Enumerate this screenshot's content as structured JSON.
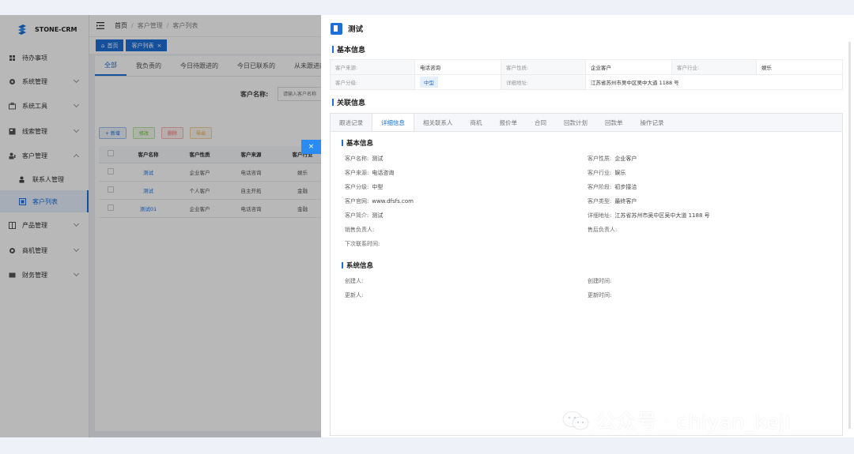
{
  "sidebar": {
    "logo": "STONE-CRM",
    "items": [
      {
        "label": "待办事项",
        "icon": "home-icon"
      },
      {
        "label": "系统管理",
        "icon": "gear-icon"
      },
      {
        "label": "系统工具",
        "icon": "tool-icon"
      },
      {
        "label": "线索管理",
        "icon": "clue-icon"
      },
      {
        "label": "客户管理",
        "icon": "user-icon"
      },
      {
        "label": "联系人管理",
        "icon": "contact-icon"
      },
      {
        "label": "客户列表",
        "icon": "list-icon"
      },
      {
        "label": "产品管理",
        "icon": "product-icon"
      },
      {
        "label": "商机管理",
        "icon": "opportunity-icon"
      },
      {
        "label": "财务管理",
        "icon": "finance-icon"
      }
    ]
  },
  "breadcrumb": [
    "首页",
    "客户管理",
    "客户列表"
  ],
  "tags": [
    {
      "label": "首页",
      "icon": "home-icon"
    },
    {
      "label": "客户列表"
    }
  ],
  "list_tabs": [
    "全部",
    "我负责的",
    "今日待跟进的",
    "今日已联系的",
    "从未跟进的"
  ],
  "search": {
    "label": "客户名称:",
    "placeholder": "请输入客户名称"
  },
  "toolbar": {
    "add": "+ 新增",
    "edit": "修改",
    "delete": "删除",
    "export": "导出"
  },
  "table": {
    "headers": [
      "客户名称",
      "客户性质",
      "客户来源",
      "客户行业"
    ],
    "rows": [
      [
        "测试",
        "企业客户",
        "电话咨询",
        "娱乐"
      ],
      [
        "测试",
        "个人客户",
        "自主开拓",
        "金融"
      ],
      [
        "测试01",
        "企业客户",
        "电话咨询",
        "金融"
      ]
    ]
  },
  "close_symbol": "×",
  "drawer": {
    "title": "测试",
    "basic_title": "基本信息",
    "basic_rows": [
      [
        "客户来源:",
        "电话咨询",
        "客户性质:",
        "企业客户",
        "客户行业:",
        "娱乐"
      ],
      [
        "客户分级:",
        "中型",
        "详细地址:",
        "江苏省苏州市吴中区吴中大道 1188 号",
        "",
        ""
      ]
    ],
    "related_title": "关联信息",
    "tabs": [
      "跟进记录",
      "详细信息",
      "相关联系人",
      "商机",
      "报价单",
      "合同",
      "回款计划",
      "回款单",
      "操作记录"
    ],
    "detail_title": "基本信息",
    "detail_left": [
      {
        "k": "客户名称:",
        "v": "测试"
      },
      {
        "k": "客户来源:",
        "v": "电话咨询"
      },
      {
        "k": "客户分级:",
        "v": "中型"
      },
      {
        "k": "客户官网:",
        "v": "www.dfsfs.com"
      },
      {
        "k": "客户简介:",
        "v": "测试"
      },
      {
        "k": "销售负责人:",
        "v": ""
      },
      {
        "k": "下次联系时间:",
        "v": ""
      }
    ],
    "detail_right": [
      {
        "k": "客户性质:",
        "v": "企业客户"
      },
      {
        "k": "客户行业:",
        "v": "娱乐"
      },
      {
        "k": "客户阶段:",
        "v": "初步接洽"
      },
      {
        "k": "客户类型:",
        "v": "最终客户"
      },
      {
        "k": "详细地址:",
        "v": "江苏省苏州市吴中区吴中大道 1188 号"
      },
      {
        "k": "售后负责人:",
        "v": ""
      }
    ],
    "system_title": "系统信息",
    "system_left": [
      {
        "k": "创建人:",
        "v": ""
      },
      {
        "k": "更新人:",
        "v": ""
      }
    ],
    "system_right": [
      {
        "k": "创建时间:",
        "v": ""
      },
      {
        "k": "更新时间:",
        "v": ""
      }
    ]
  },
  "watermark": "公众号 · chiyan_keji",
  "colors": {
    "accent": "#1e6fd9"
  }
}
